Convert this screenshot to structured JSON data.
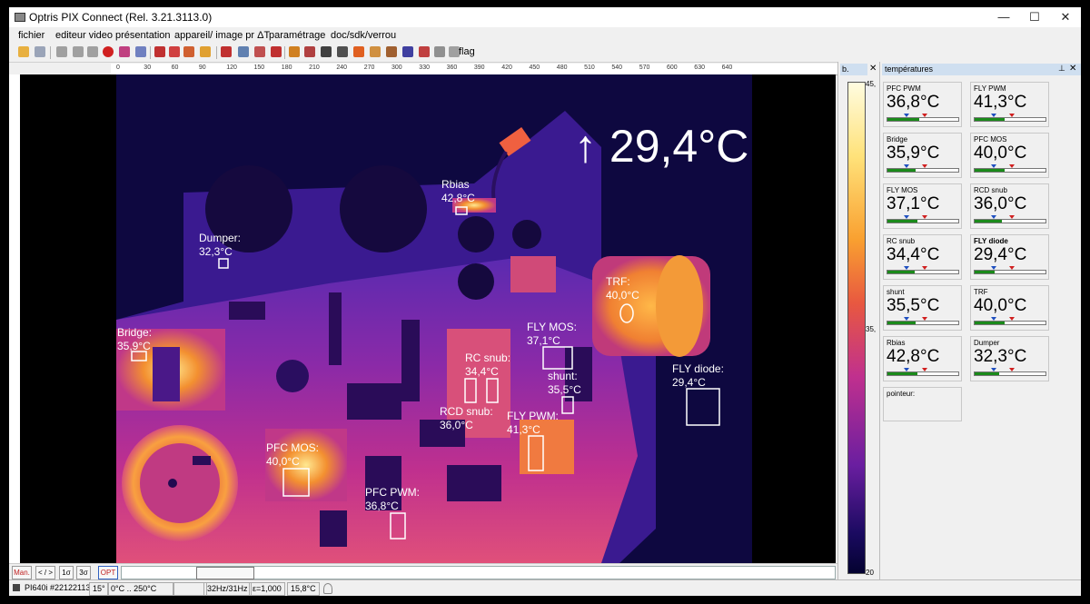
{
  "window": {
    "title": "Optris PIX Connect (Rel. 3.21.3113.0)",
    "controls": {
      "minimize": "—",
      "maximize": "☐",
      "close": "✕"
    }
  },
  "menu": [
    "fichier",
    "editeur video",
    "présentation",
    "appareil/ image pr ΔT",
    "paramétrage",
    "doc/sdk/verrou"
  ],
  "toolbar": {
    "flag": "flag"
  },
  "ruler_ticks": [
    "0",
    "30",
    "60",
    "90",
    "120",
    "150",
    "180",
    "210",
    "240",
    "270",
    "300",
    "330",
    "360",
    "390",
    "420",
    "450",
    "480",
    "510",
    "540",
    "570",
    "600",
    "630",
    "640"
  ],
  "thermal": {
    "colors": {
      "bg": "#0c0640",
      "hot": "#ffd060",
      "orange": "#f28030",
      "magenta": "#b02898",
      "purple": "#6a2aa0",
      "label": "#ffffff"
    },
    "max_readout": "↑ 29,4°C",
    "labels": [
      {
        "name": "Rbias",
        "value": "42,8°C"
      },
      {
        "name": "Dumper:",
        "value": "32,3°C"
      },
      {
        "name": "TRF:",
        "value": "40,0°C"
      },
      {
        "name": "Bridge:",
        "value": "35,9°C"
      },
      {
        "name": "FLY MOS:",
        "value": "37,1°C"
      },
      {
        "name": "RC snub:",
        "value": "34,4°C"
      },
      {
        "name": "shunt:",
        "value": "35,5°C"
      },
      {
        "name": "FLY diode:",
        "value": "29,4°C"
      },
      {
        "name": "RCD snub:",
        "value": "36,0°C"
      },
      {
        "name": "FLY PWM:",
        "value": "41,3°C"
      },
      {
        "name": "PFC MOS:",
        "value": "40,0°C"
      },
      {
        "name": "PFC PWM:",
        "value": "36,8°C"
      }
    ]
  },
  "bottom_buttons": [
    "Man.",
    "< / >",
    "1σ",
    "3σ",
    "OPT"
  ],
  "status": {
    "camera": "PI640i #22122113",
    "fov": "15°",
    "range": "0°C .. 250°C",
    "framerate": "32Hz/31Hz",
    "emissivity": "ε=1,000",
    "ambient": "15,8°C"
  },
  "scale_panel": {
    "header": "b.",
    "top": "45,",
    "mid": "35,",
    "bottom": "20"
  },
  "temps_panel": {
    "header": "températures",
    "tiles": [
      {
        "name": "PFC PWM",
        "value": "36,8°C",
        "bold": false,
        "level": 0.45
      },
      {
        "name": "FLY PWM",
        "value": "41,3°C",
        "bold": false,
        "level": 0.42
      },
      {
        "name": "Bridge",
        "value": "35,9°C",
        "bold": false,
        "level": 0.4
      },
      {
        "name": "PFC MOS",
        "value": "40,0°C",
        "bold": false,
        "level": 0.42
      },
      {
        "name": "FLY MOS",
        "value": "37,1°C",
        "bold": false,
        "level": 0.42
      },
      {
        "name": "RCD snub",
        "value": "36,0°C",
        "bold": false,
        "level": 0.38
      },
      {
        "name": "RC snub",
        "value": "34,4°C",
        "bold": false,
        "level": 0.38
      },
      {
        "name": "FLY diode",
        "value": "29,4°C",
        "bold": true,
        "level": 0.28
      },
      {
        "name": "shunt",
        "value": "35,5°C",
        "bold": false,
        "level": 0.4
      },
      {
        "name": "TRF",
        "value": "40,0°C",
        "bold": false,
        "level": 0.42
      },
      {
        "name": "Rbias",
        "value": "42,8°C",
        "bold": false,
        "level": 0.42
      },
      {
        "name": "Dumper",
        "value": "32,3°C",
        "bold": false,
        "level": 0.34
      }
    ],
    "pointer_label": "pointeur:"
  }
}
